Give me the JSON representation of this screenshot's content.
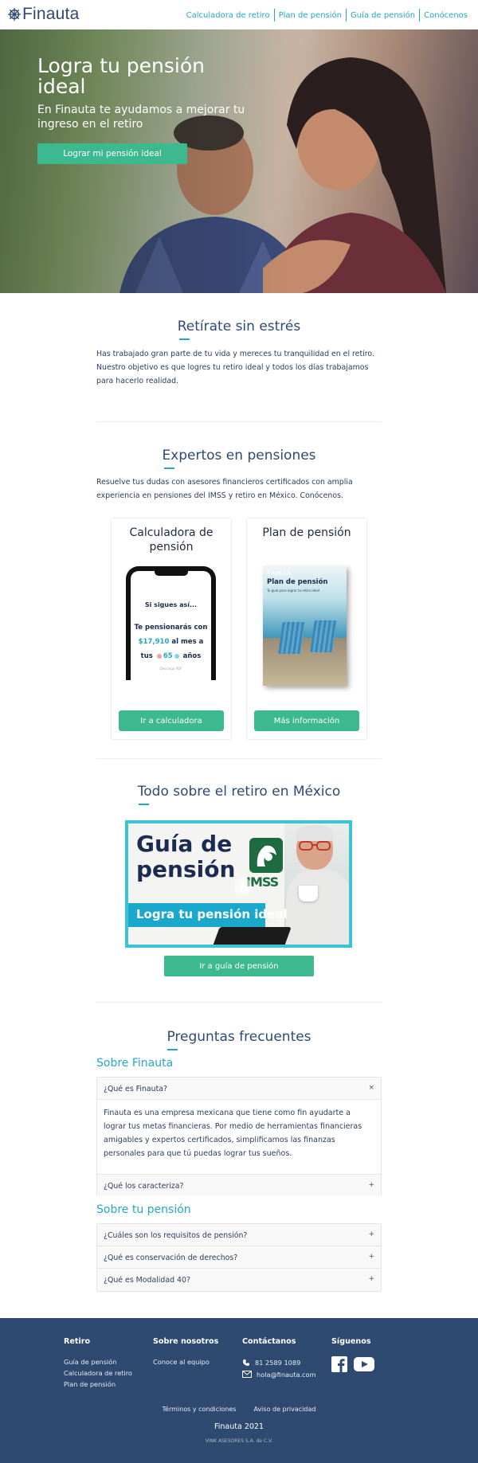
{
  "nav": {
    "brand": "Finauta",
    "links": [
      "Calculadora de retiro",
      "Plan de pensión",
      "Guía de pensión",
      "Conócenos"
    ],
    "link_color": "#26a6c6"
  },
  "hero": {
    "title": "Logra tu pensión ideal",
    "subtitle": "En Finauta te ayudamos a mejorar tu ingreso en el retiro",
    "cta": "Lograr mi pensión ideal"
  },
  "section_stress": {
    "title": "Retírate sin estrés",
    "text": "Has trabajado gran parte de tu vida y mereces tu tranquilidad en el retiro. Nuestro objetivo es que logres tu retiro ideal y todos los días trabajamos para hacerlo realidad."
  },
  "section_experts": {
    "title": "Expertos en pensiones",
    "text": "Resuelve tus dudas con asesores financieros certificados con amplia experiencia en pensiones del IMSS y retiro en México. Conócenos.",
    "cards": [
      {
        "title": "Calculadora de pensión",
        "button": "Ir a calculadora",
        "phone": {
          "line1": "Si sigues así...",
          "line2": "Te pensionarás con",
          "amount": "$17,910",
          "per": "al mes a",
          "tus": "tus",
          "age": "65",
          "years": "años",
          "note": "Descarga PDF"
        }
      },
      {
        "title": "Plan de pensión",
        "button": "Más información",
        "book": {
          "brand": "Finauta",
          "title": "Plan de pensión",
          "subtitle": "Tu guía para lograr tu retiro ideal"
        }
      }
    ]
  },
  "section_guide": {
    "title": "Todo sobre el retiro en México",
    "banner_title_1": "Guía de",
    "banner_title_2": "pensión",
    "banner_logo": "IMSS",
    "banner_ribbon": "Logra tu pensión ideal",
    "button": "Ir a guía de pensión"
  },
  "faq": {
    "title": "Preguntas frecuentes",
    "groups": [
      {
        "name": "Sobre Finauta",
        "items": [
          {
            "q": "¿Qué es Finauta?",
            "toggle": "×",
            "a": "Finauta es una empresa mexicana que tiene como fin ayudarte a lograr tus metas financieras. Por medio de herramientas financieras amigables y expertos certificados, simplificamos las finanzas personales para que tú puedas lograr tus sueños."
          },
          {
            "q": "¿Qué los caracteriza?",
            "toggle": "+"
          }
        ]
      },
      {
        "name": "Sobre tu pensión",
        "items": [
          {
            "q": "¿Cuáles son los requisitos de pensión?",
            "toggle": "+"
          },
          {
            "q": "¿Qué es conservación de derechos?",
            "toggle": "+"
          },
          {
            "q": "¿Qué es Modalidad 40?",
            "toggle": "+"
          }
        ]
      }
    ]
  },
  "footer": {
    "col1": {
      "head": "Retiro",
      "links": [
        "Guía de pensión",
        "Calculadora de retiro",
        "Plan de pensión"
      ]
    },
    "col2": {
      "head": "Sobre nosotros",
      "links": [
        "Conoce al equipo"
      ]
    },
    "col3": {
      "head": "Contáctanos",
      "phone": "81 2589 1089",
      "email": "hola@finauta.com"
    },
    "col4": {
      "head": "Síguenos",
      "icons": [
        "facebook-icon",
        "youtube-icon"
      ]
    },
    "terms": "Términos y condiciones",
    "privacy": "Aviso de privacidad",
    "copyright": "Finauta 2021",
    "legal": "VINK ASESORES S.A. de C.V."
  },
  "colors": {
    "accent": "#26a6c6",
    "button": "#3db98f",
    "heading": "#2e4a74",
    "footer": "#2e4a70"
  }
}
